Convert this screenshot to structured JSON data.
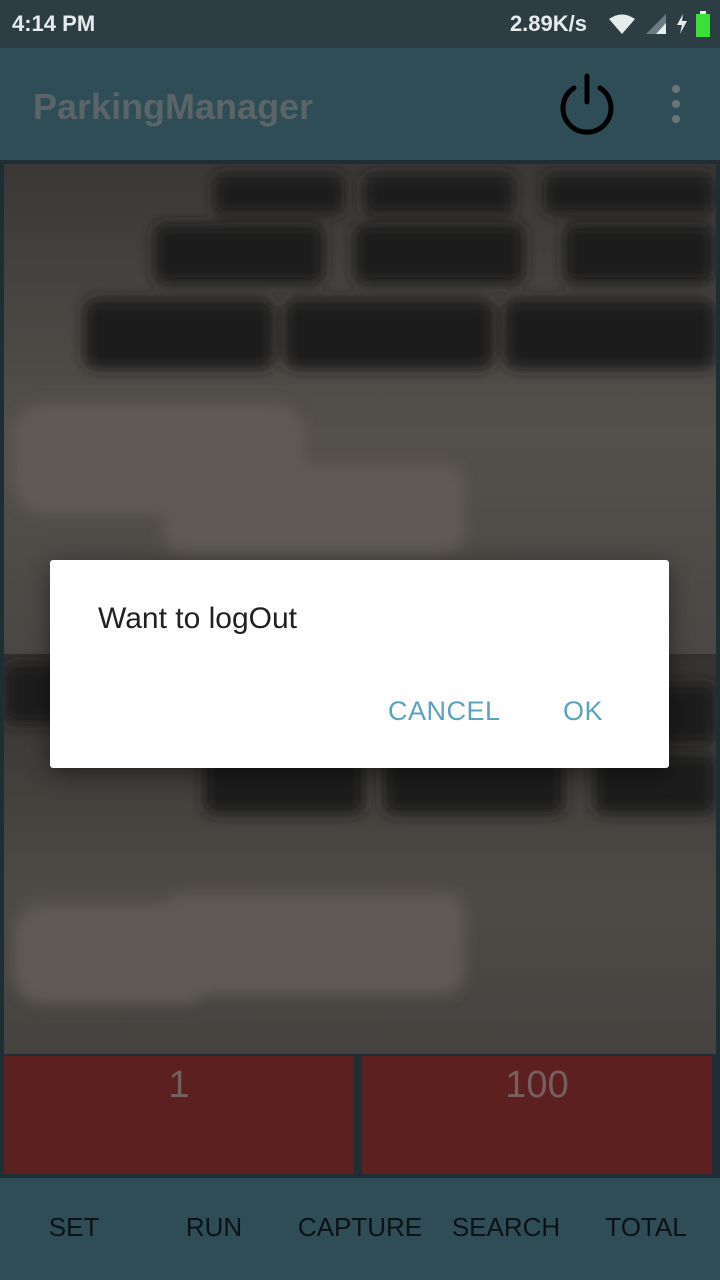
{
  "status_bar": {
    "time": "4:14 PM",
    "network_speed": "2.89K/s",
    "icons": [
      "wifi-icon",
      "signal-icon",
      "charging-icon",
      "battery-icon"
    ]
  },
  "app_bar": {
    "title": "ParkingManager",
    "actions": [
      "power-icon",
      "more-vert-icon"
    ]
  },
  "panels": {
    "left_value": "1",
    "right_value": "100"
  },
  "bottom_nav": {
    "items": [
      "SET",
      "RUN",
      "CAPTURE",
      "SEARCH",
      "TOTAL"
    ]
  },
  "dialog": {
    "message": "Want to logOut",
    "cancel_label": "CANCEL",
    "ok_label": "OK"
  },
  "colors": {
    "accent": "#5aa3bd",
    "app_bar": "#2f4d57",
    "panel": "#5c2021",
    "battery": "#3adf3a"
  }
}
